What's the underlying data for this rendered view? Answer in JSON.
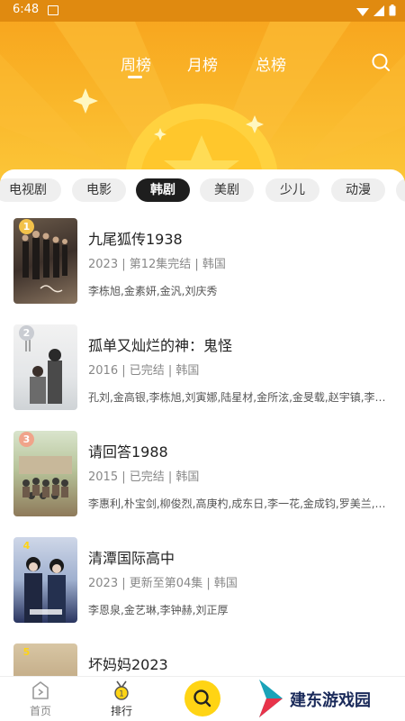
{
  "status": {
    "time": "6:48"
  },
  "top_tabs": [
    {
      "label": "周榜",
      "active": true
    },
    {
      "label": "月榜",
      "active": false
    },
    {
      "label": "总榜",
      "active": false
    }
  ],
  "categories": [
    {
      "label": "电视剧",
      "active": false
    },
    {
      "label": "电影",
      "active": false
    },
    {
      "label": "韩剧",
      "active": true
    },
    {
      "label": "美剧",
      "active": false
    },
    {
      "label": "少儿",
      "active": false
    },
    {
      "label": "动漫",
      "active": false
    }
  ],
  "items": [
    {
      "rank": "1",
      "title": "九尾狐传1938",
      "meta": "2023 | 第12集完结 | 韩国",
      "cast": "李栋旭,金素妍,金汎,刘庆秀"
    },
    {
      "rank": "2",
      "title": "孤单又灿烂的神：鬼怪",
      "meta": "2016 | 已完结 | 韩国",
      "cast": "孔刘,金高银,李栋旭,刘寅娜,陆星材,金所泫,金旻载,赵宇镇,李艾..."
    },
    {
      "rank": "3",
      "title": "请回答1988",
      "meta": "2015 | 已完结 | 韩国",
      "cast": "李惠利,朴宝剑,柳俊烈,高庚杓,成东日,李一花,金成钧,罗美兰,李..."
    },
    {
      "rank": "4",
      "title": "清潭国际高中",
      "meta": "2023 | 更新至第04集 | 韩国",
      "cast": "李恩泉,金艺琳,李钟赫,刘正厚"
    },
    {
      "rank": "5",
      "title": "坏妈妈2023",
      "meta": "",
      "cast": ""
    }
  ],
  "nav": [
    {
      "label": "首页",
      "icon": "home-icon"
    },
    {
      "label": "排行",
      "icon": "ranking-medal-icon"
    }
  ],
  "watermark": "建东游戏园",
  "colors": {
    "accent": "#f9b428",
    "search_button": "#ffd414",
    "active_chip": "#1e1e1e"
  }
}
